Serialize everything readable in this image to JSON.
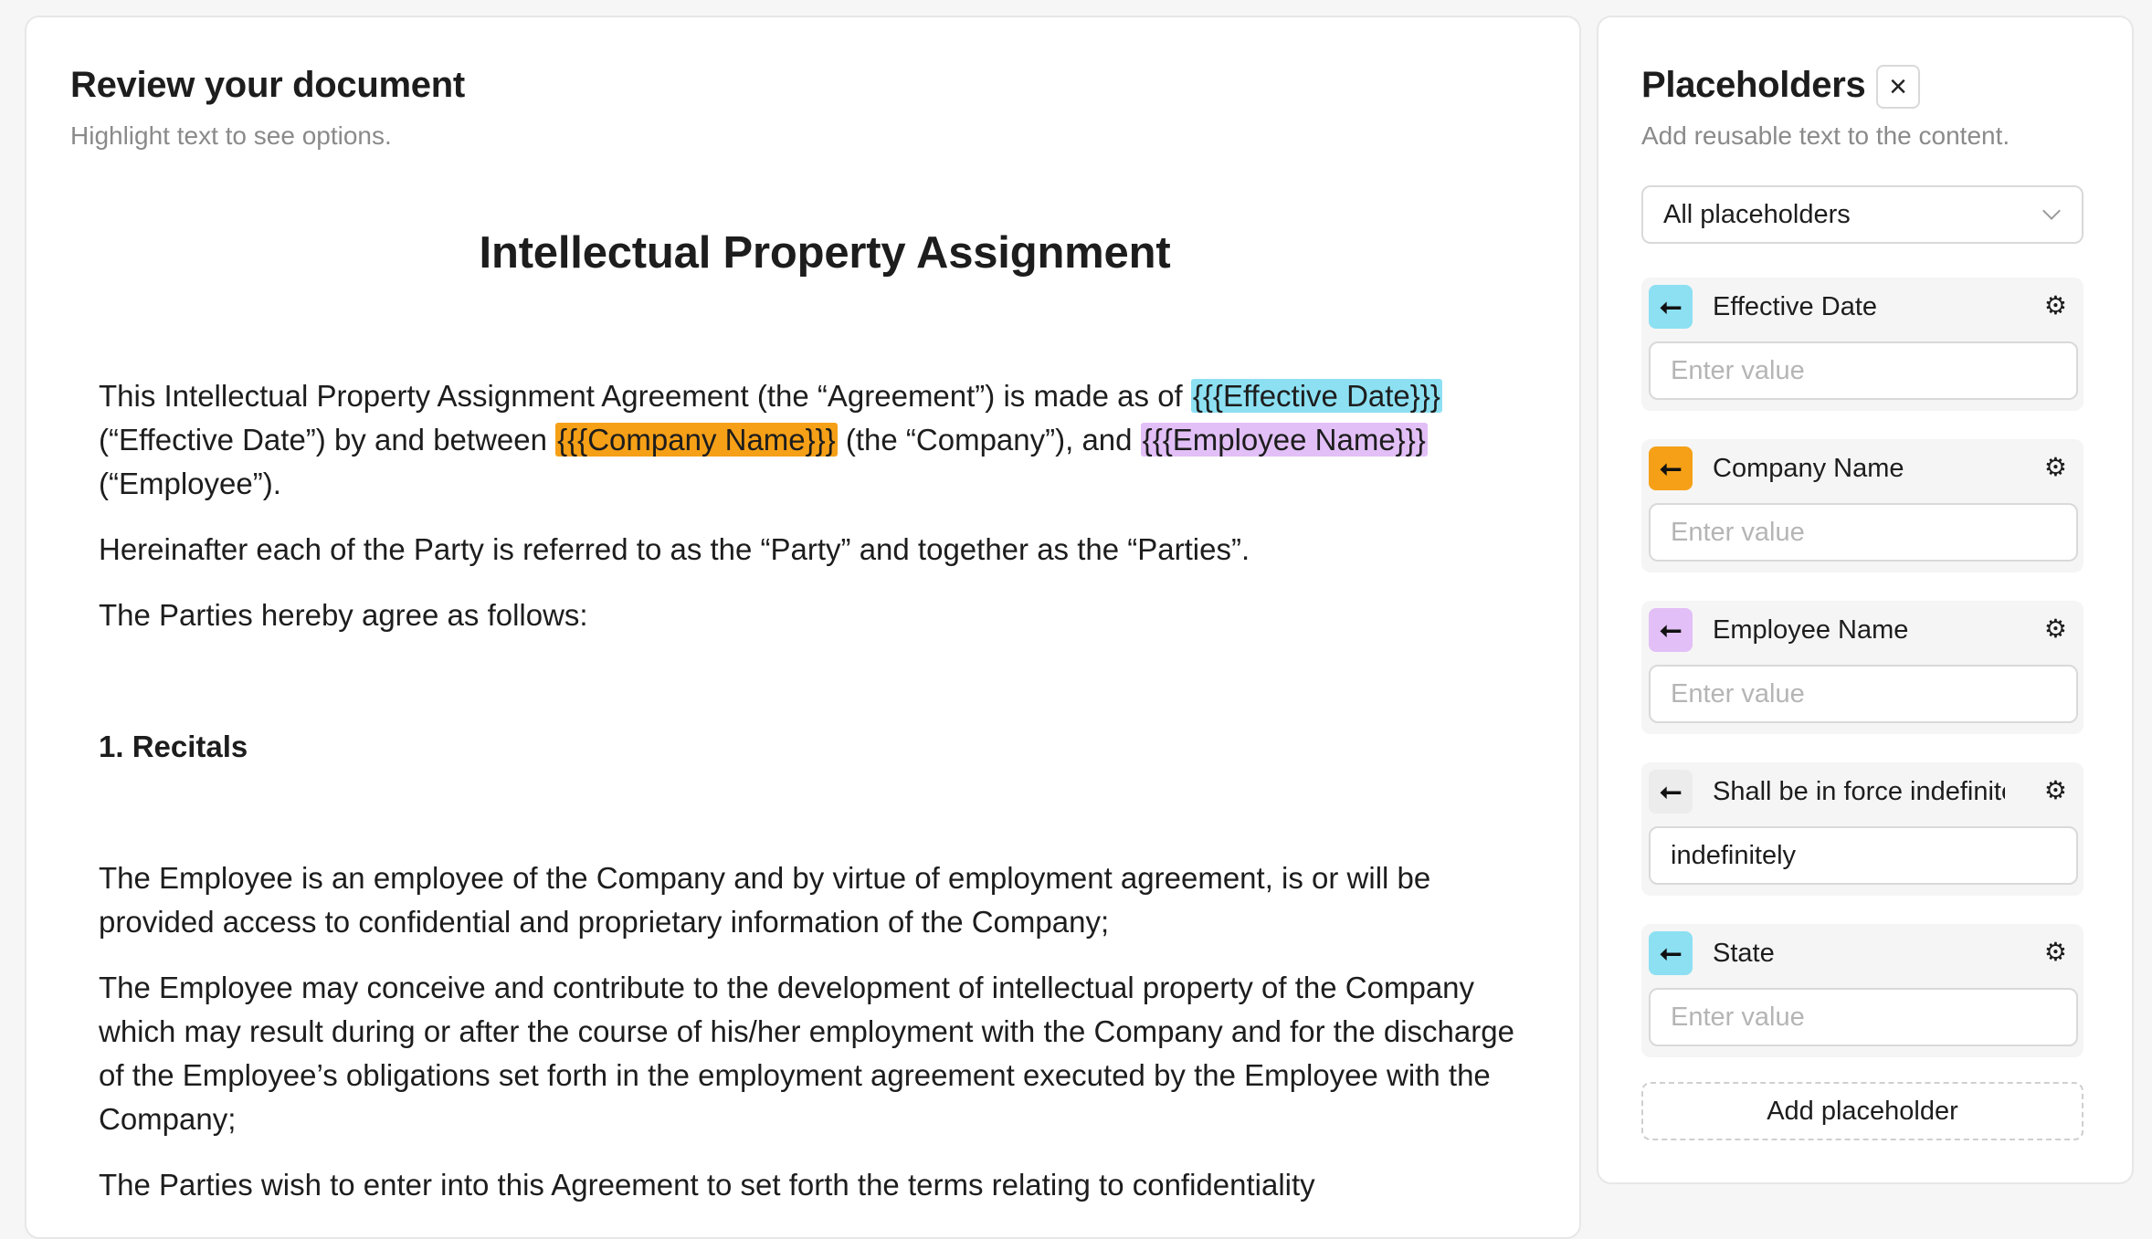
{
  "review": {
    "title": "Review your document",
    "subtitle": "Highlight text to see options."
  },
  "document": {
    "title": "Intellectual Property Assignment",
    "p1": {
      "a": "This Intellectual Property Assignment Agreement (the “Agreement”) is made as of ",
      "effective_date": "{{{Effective Date}}}",
      "b": " (“Effective Date”) by and between ",
      "company_name": "{{{Company Name}}}",
      "c": " (the “Company”), and ",
      "employee_name": "{{{Employee Name}}}",
      "d": " (“Employee”)."
    },
    "p2": "Hereinafter each of the Party is referred to as the “Party” and together as the “Parties”.",
    "p3": "The Parties hereby agree as follows:",
    "section1_heading": "1. Recitals",
    "p4": "The Employee is an employee of the Company and by virtue of employment agreement, is or will be provided access to confidential and proprietary information of the Company;",
    "p5": "The Employee may conceive and contribute to the development of intellectual property of the Company which may result during or after the course of his/her employment with the Company and for the discharge of the Employee’s obligations set forth in the employment agreement executed by the Employee with the Company;",
    "p6": "The Parties wish to enter into this Agreement to set forth the terms relating to confidentiality"
  },
  "placeholders": {
    "title": "Placeholders",
    "close_label": "×",
    "subtitle": "Add reusable text to the content.",
    "filter_value": "All placeholders",
    "items": [
      {
        "label": "Effective Date",
        "color": "#8ce0f2",
        "value": "",
        "placeholder": "Enter value"
      },
      {
        "label": "Company Name",
        "color": "#f5a017",
        "value": "",
        "placeholder": "Enter value"
      },
      {
        "label": "Employee Name",
        "color": "#e2bff6",
        "value": "",
        "placeholder": "Enter value"
      },
      {
        "label": "Shall be in force indefinitely",
        "color": "#ececec",
        "value": "indefinitely",
        "placeholder": "Enter value"
      },
      {
        "label": "State",
        "color": "#8ce0f2",
        "value": "",
        "placeholder": "Enter value"
      }
    ],
    "badge_glyph": "⭠",
    "gear_glyph": "⚙",
    "add_label": "Add placeholder"
  }
}
